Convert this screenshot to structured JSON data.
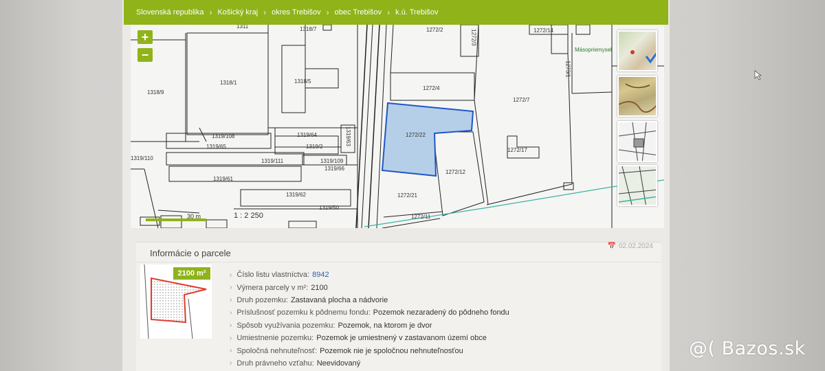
{
  "breadcrumb": [
    "Slovenská republika",
    "Košický kraj",
    "okres Trebišov",
    "obec Trebišov",
    "k.ú. Trebišov"
  ],
  "map": {
    "zoom_in": "+",
    "zoom_out": "−",
    "scale_text": "1 : 2 250",
    "scale_bar_label": "30 m",
    "highlight_color": "#b5cfe8",
    "parcel_labels": [
      "1318/7",
      "1272/2",
      "1272/3",
      "1272/14",
      "1318/9",
      "1318/1",
      "1318/5",
      "1272/4",
      "1272/7",
      "1273/1",
      "1319/108",
      "1319/64",
      "1319/63",
      "1319/65",
      "1319/2",
      "1272/22",
      "1272/17",
      "1319/110",
      "1319/111",
      "1319/109",
      "1319/66",
      "1272/12",
      "1319/61",
      "1319/62",
      "1272/21",
      "1319/50",
      "1272/11",
      "1311"
    ],
    "place_label": "Mäsopriemysel",
    "layers": [
      "layer-ortho-icon",
      "layer-terrain-icon",
      "layer-overview-icon",
      "layer-cadastre-icon"
    ]
  },
  "info": {
    "title": "Informácie o parcele",
    "date": "02.02.2024",
    "area_badge": "2100 m²",
    "rows": [
      {
        "label": "Číslo listu vlastníctva:",
        "value": "8942"
      },
      {
        "label": "Výmera parcely v m²:",
        "value": "2100"
      },
      {
        "label": "Druh pozemku:",
        "value": "Zastavaná plocha a nádvorie"
      },
      {
        "label": "Príslušnosť pozemku k pôdnemu fondu:",
        "value": "Pozemok nezaradený do pôdneho fondu"
      },
      {
        "label": "Spôsob využívania pozemku:",
        "value": "Pozemok, na ktorom je dvor"
      },
      {
        "label": "Umiestnenie pozemku:",
        "value": "Pozemok je umiestnený v zastavanom území obce"
      },
      {
        "label": "Spoločná nehnuteľnosť:",
        "value": "Pozemok nie je spoločnou nehnuteľnosťou"
      },
      {
        "label": "Druh právneho vzťahu:",
        "value": "Neevidovaný"
      }
    ]
  },
  "watermark": "@( Bazos.sk",
  "colors": {
    "accent": "#8fb319",
    "link": "#2f5ea8",
    "highlight_fill": "#b5cfe8",
    "highlight_stroke": "#1f55c8",
    "minimap_red": "#e23b2e"
  }
}
